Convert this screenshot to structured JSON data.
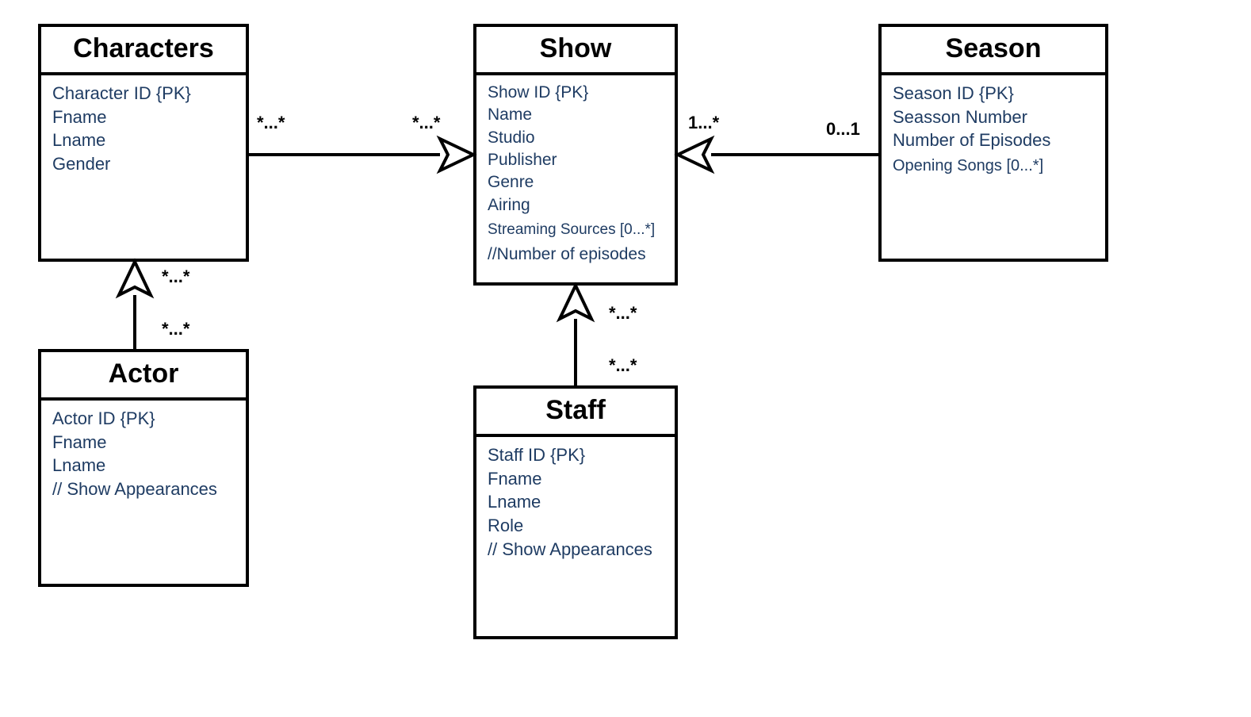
{
  "entities": {
    "characters": {
      "title": "Characters",
      "attrs": [
        "Character ID   {PK}",
        "Fname",
        "Lname",
        "Gender"
      ]
    },
    "show": {
      "title": "Show",
      "attrs": [
        "Show ID   {PK}",
        "Name",
        "Studio",
        "Publisher",
        "Genre",
        "Airing",
        "Streaming Sources   [0...*]",
        "//Number of episodes"
      ]
    },
    "season": {
      "title": "Season",
      "attrs": [
        "Season ID   {PK}",
        "Seasson Number",
        "Number of Episodes",
        "Opening Songs   [0...*]"
      ]
    },
    "actor": {
      "title": "Actor",
      "attrs": [
        "Actor ID   {PK}",
        "Fname",
        "Lname",
        "//  Show Appearances"
      ]
    },
    "staff": {
      "title": "Staff",
      "attrs": [
        "Staff ID   {PK}",
        "Fname",
        "Lname",
        "Role",
        "//  Show Appearances"
      ]
    }
  },
  "mult": {
    "char_show_left": "*...*",
    "char_show_right": "*...*",
    "show_season_left": "1...*",
    "show_season_right": "0...1",
    "actor_char_top": "*...*",
    "actor_char_bottom": "*...*",
    "staff_show_top": "*...*",
    "staff_show_bottom": "*...*"
  }
}
